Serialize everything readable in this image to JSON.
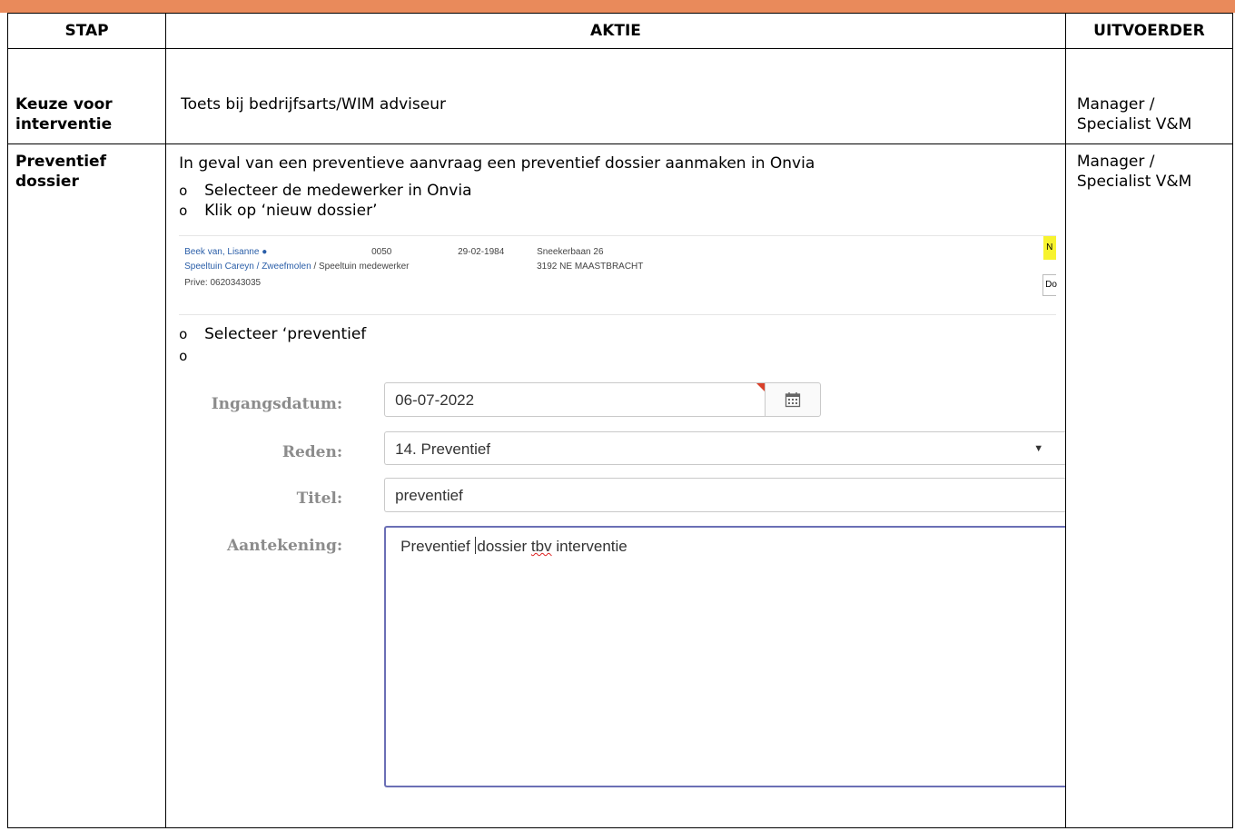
{
  "header": {
    "stap": "STAP",
    "aktie": "AKTIE",
    "uitvoerder": "UITVOERDER"
  },
  "rows": [
    {
      "stap": "Keuze voor interventie",
      "aktie": "Toets bij bedrijfsarts/WIM adviseur",
      "uitvoerder": "Manager / Specialist V&M"
    },
    {
      "stap": "Preventief dossier",
      "aktie_intro": "In geval van een preventieve aanvraag een preventief dossier aanmaken in Onvia",
      "bullets_a": [
        "Selecteer de medewerker in Onvia",
        "Klik op ‘nieuw dossier’"
      ],
      "bullets_b": [
        "Selecteer ‘preventief",
        ""
      ],
      "bullet_glyph": "o",
      "uitvoerder": "Manager / Specialist V&M"
    }
  ],
  "employee_screenshot": {
    "name": "Beek van, Lisanne",
    "org_link_1": "Speeltuin Careyn",
    "org_link_2": "Zweefmolen",
    "org_rest": "/ Speeltuin medewerker",
    "org_sep": "/",
    "phone": "Prive: 0620343035",
    "number": "0050",
    "birthdate": "29-02-1984",
    "street": "Sneekerbaan 26",
    "city": "3192 NE MAASTBRACHT",
    "button_partial": "N",
    "input_partial": "Do"
  },
  "form": {
    "ingangsdatum_label": "Ingangsdatum:",
    "ingangsdatum_value": "06-07-2022",
    "reden_label": "Reden:",
    "reden_value": "14. Preventief",
    "titel_label": "Titel:",
    "titel_value": "preventief",
    "aantekening_label": "Aantekening:",
    "aantekening_part1": "Preventief ",
    "aantekening_part2": "dossier ",
    "aantekening_misspelled": "tbv",
    "aantekening_part3": " interventie"
  }
}
